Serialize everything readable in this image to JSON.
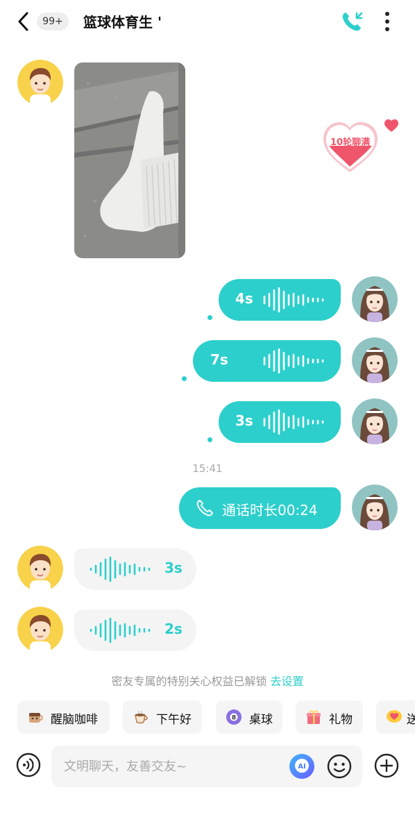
{
  "header": {
    "unread_badge": "99+",
    "title": "篮球体育生 '"
  },
  "heart_badge": {
    "label": "10轮聊满"
  },
  "messages": {
    "voice_out_1": "4s",
    "voice_out_2": "7s",
    "voice_out_3": "3s",
    "timestamp": "15:41",
    "call_record": "通话时长00:24",
    "voice_in_1": "3s",
    "voice_in_2": "2s"
  },
  "notice": {
    "text": "密友专属的特别关心权益已解锁",
    "link": "去设置"
  },
  "quick_chips": [
    {
      "label": "醒脑咖啡",
      "icon": "coffee-face-icon"
    },
    {
      "label": "下午好",
      "icon": "coffee-cup-icon"
    },
    {
      "label": "桌球",
      "icon": "billiard-ball-icon"
    },
    {
      "label": "礼物",
      "icon": "gift-icon"
    },
    {
      "label": "送",
      "icon": "heart-chat-icon"
    }
  ],
  "input": {
    "placeholder": "文明聊天，友善交友~"
  },
  "colors": {
    "accent": "#2ccfcb",
    "bubble_in": "#f4f4f4",
    "heart": "#f0566b"
  }
}
